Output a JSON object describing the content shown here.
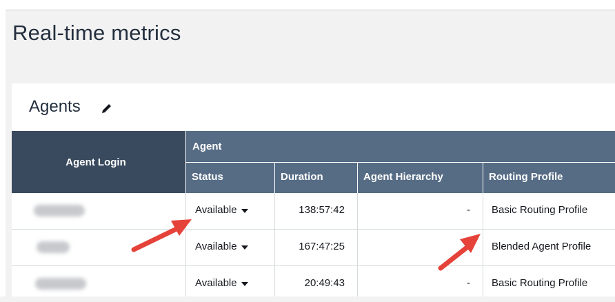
{
  "page": {
    "title": "Real-time metrics"
  },
  "section": {
    "title": "Agents",
    "edit_icon": "pencil-icon"
  },
  "table": {
    "login_header": "Agent Login",
    "group_header": "Agent",
    "columns": [
      "Status",
      "Duration",
      "Agent Hierarchy",
      "Routing Profile"
    ],
    "rows": [
      {
        "status": "Available",
        "duration": "138:57:42",
        "hierarchy": "-",
        "routing_profile": "Basic Routing Profile"
      },
      {
        "status": "Available",
        "duration": "167:47:25",
        "hierarchy": "",
        "routing_profile": "Blended Agent Profile"
      },
      {
        "status": "Available",
        "duration": "20:49:43",
        "hierarchy": "-",
        "routing_profile": "Basic Routing Profile"
      }
    ]
  },
  "colors": {
    "header_dark": "#3a4a5e",
    "header_mid": "#566c85",
    "annotation_arrow": "#e5423a"
  }
}
